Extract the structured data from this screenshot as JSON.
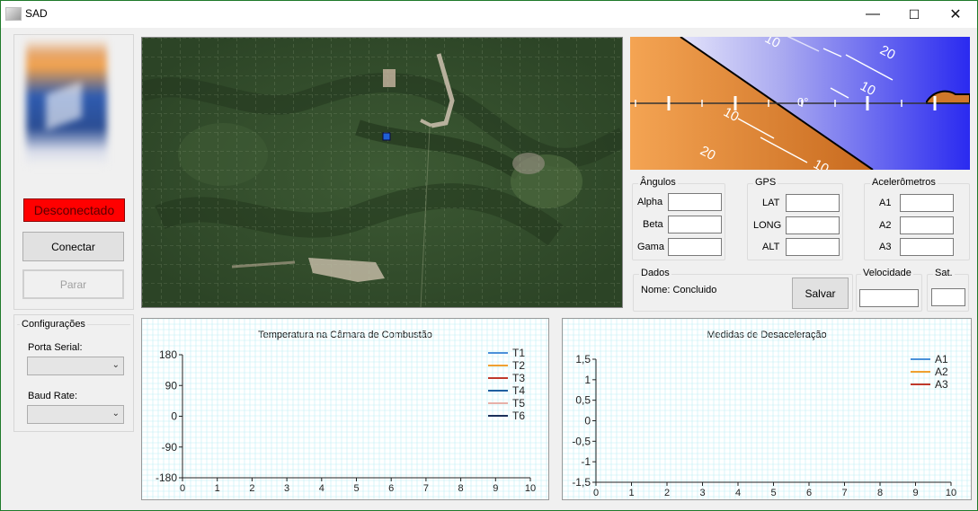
{
  "window": {
    "title": "SAD",
    "minimize": "—",
    "maximize": "☐",
    "close": "✕"
  },
  "left": {
    "status": "Desconectado",
    "connect_button": "Conectar",
    "stop_button": "Parar",
    "config": {
      "title": "Configurações",
      "serial_label": "Porta Serial:",
      "serial_value": "",
      "baud_label": "Baud Rate:",
      "baud_value": ""
    }
  },
  "horizon": {
    "labels": [
      "10",
      "20",
      "10",
      "0°",
      "10",
      "20",
      "10"
    ]
  },
  "angles": {
    "title": "Ângulos",
    "alpha": "Alpha",
    "beta": "Beta",
    "gama": "Gama"
  },
  "gps": {
    "title": "GPS",
    "lat": "LAT",
    "long": "LONG",
    "alt": "ALT"
  },
  "accel": {
    "title": "Acelerômetros",
    "a1": "A1",
    "a2": "A2",
    "a3": "A3"
  },
  "dados": {
    "title": "Dados",
    "name": "Nome: Concluido",
    "save_button": "Salvar"
  },
  "velocidade": {
    "title": "Velocidade"
  },
  "sat": {
    "title": "Sat."
  },
  "colors": {
    "status_bg": "#ff0000",
    "accent_blue": "#1f5fd6"
  },
  "chart_data": [
    {
      "type": "line",
      "title": "Temperatura na Câmara de Combustão",
      "xlim": [
        0,
        10
      ],
      "ylim": [
        -180,
        180
      ],
      "xticks": [
        "0",
        "1",
        "2",
        "3",
        "4",
        "5",
        "6",
        "7",
        "8",
        "9",
        "10"
      ],
      "yticks": [
        "180",
        "90",
        "0",
        "-90",
        "-180"
      ],
      "series": [
        {
          "name": "T1",
          "color": "#4a90d9",
          "values": []
        },
        {
          "name": "T2",
          "color": "#f0a030",
          "values": []
        },
        {
          "name": "T3",
          "color": "#c0392b",
          "values": []
        },
        {
          "name": "T4",
          "color": "#1f5fa0",
          "values": []
        },
        {
          "name": "T5",
          "color": "#e8b0a8",
          "values": []
        },
        {
          "name": "T6",
          "color": "#1a2f5a",
          "values": []
        }
      ],
      "grid": true,
      "legend": "top-right"
    },
    {
      "type": "line",
      "title": "Medidas de Desaceleração",
      "xlim": [
        0,
        10
      ],
      "ylim": [
        -1.5,
        1.5
      ],
      "xticks": [
        "0",
        "1",
        "2",
        "3",
        "4",
        "5",
        "6",
        "7",
        "8",
        "9",
        "10"
      ],
      "yticks": [
        "1,5",
        "1",
        "0,5",
        "0",
        "-0,5",
        "-1",
        "-1,5"
      ],
      "series": [
        {
          "name": "A1",
          "color": "#4a90d9",
          "values": []
        },
        {
          "name": "A2",
          "color": "#f0a030",
          "values": []
        },
        {
          "name": "A3",
          "color": "#c0392b",
          "values": []
        }
      ],
      "grid": true,
      "legend": "top-right"
    }
  ]
}
